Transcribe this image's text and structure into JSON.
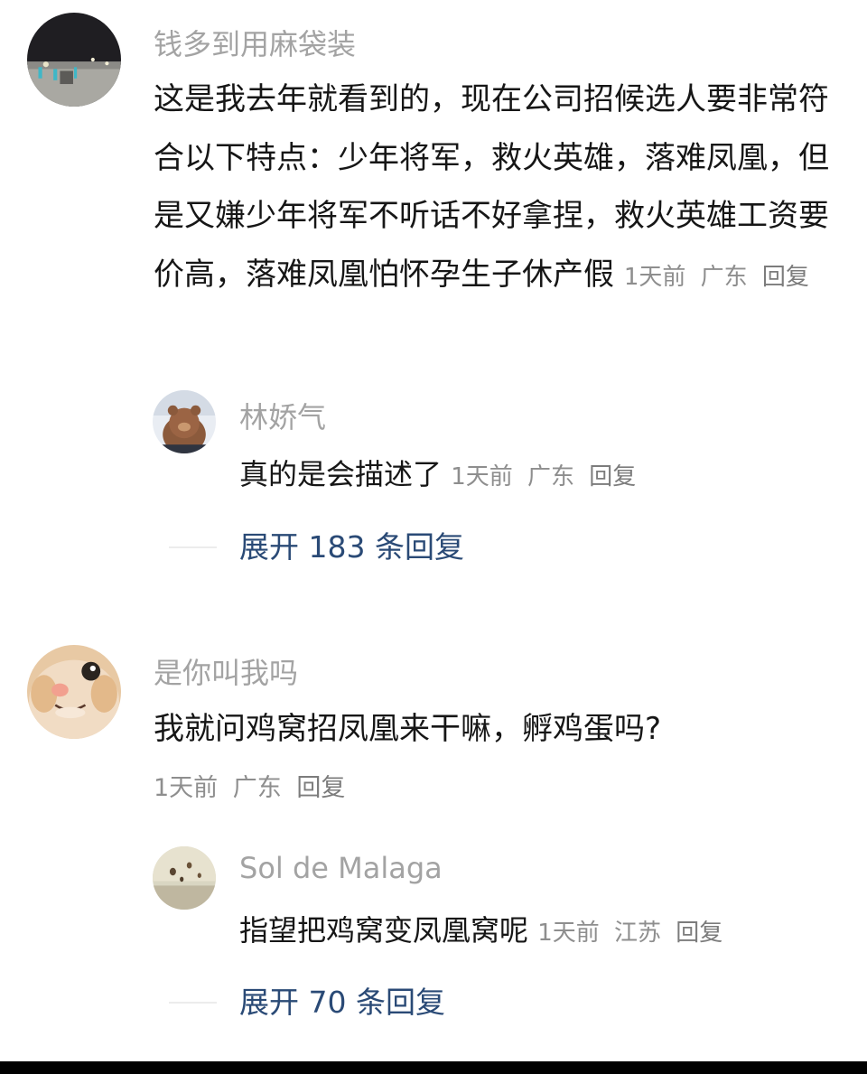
{
  "comments": [
    {
      "username": "钱多到用麻袋装",
      "text": "这是我去年就看到的，现在公司招候选人要非常符合以下特点：少年将军，救火英雄，落难凤凰，但是又嫌少年将军不听话不好拿捏，救火英雄工资要价高，落难凤凰怕怀孕生子休产假",
      "time": "1天前",
      "location": "广东",
      "reply_label": "回复",
      "avatar_icon": "night-city-avatar",
      "replies": [
        {
          "username": "林娇气",
          "text": "真的是会描述了",
          "time": "1天前",
          "location": "广东",
          "reply_label": "回复",
          "avatar_icon": "bear-avatar"
        }
      ],
      "expand_label": "展开 183 条回复"
    },
    {
      "username": "是你叫我吗",
      "text": "我就问鸡窝招凤凰来干嘛，孵鸡蛋吗?",
      "time": "1天前",
      "location": "广东",
      "reply_label": "回复",
      "avatar_icon": "cat-face-avatar",
      "replies": [
        {
          "username": "Sol de Malaga",
          "text": "指望把鸡窝变凤凰窝呢",
          "time": "1天前",
          "location": "江苏",
          "reply_label": "回复",
          "avatar_icon": "hot-air-balloon-avatar"
        }
      ],
      "expand_label": "展开 70 条回复"
    }
  ],
  "colors": {
    "username": "#a3a3a3",
    "text": "#161616",
    "meta": "#8e8e8e",
    "expand": "#2a4a76"
  }
}
